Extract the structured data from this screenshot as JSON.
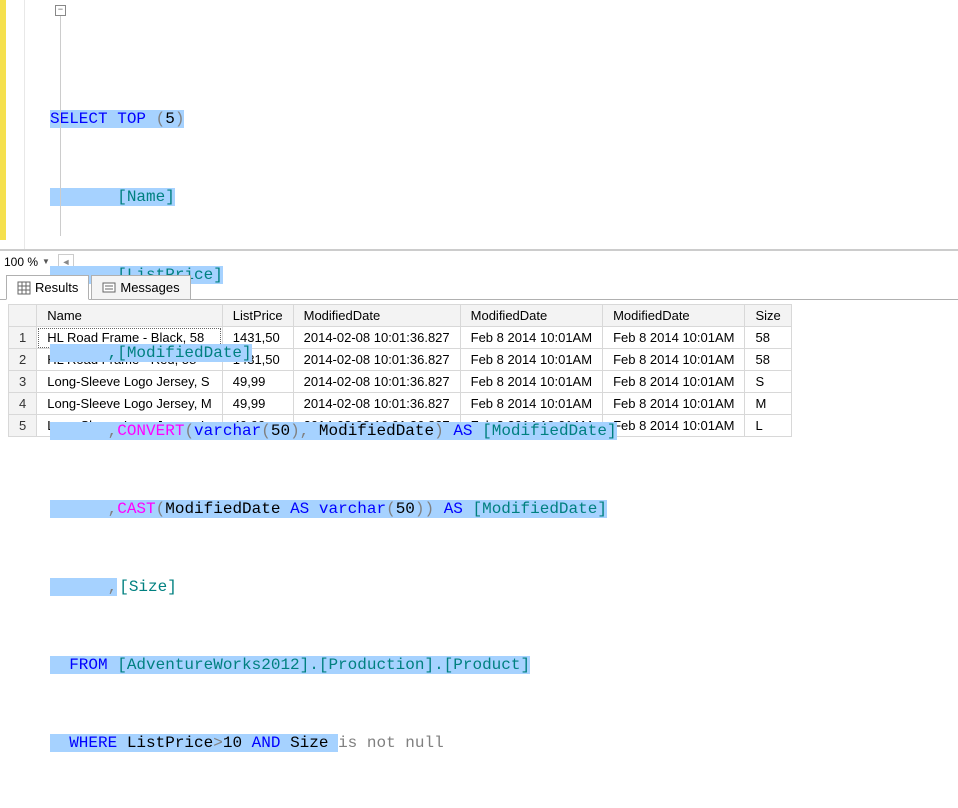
{
  "zoom": {
    "level": "100 %"
  },
  "code": {
    "collapse_glyph": "−",
    "line1_a": "SELECT",
    "line1_b": " TOP ",
    "line1_c": "(",
    "line1_d": "5",
    "line1_e": ")",
    "line2": "       [Name]",
    "line3": "      ,[ListPrice]",
    "line4": "      ,[ModifiedDate]",
    "line5_a": "      ,",
    "line5_b": "CONVERT",
    "line5_c": "(",
    "line5_d": "varchar",
    "line5_e": "(",
    "line5_f": "50",
    "line5_g": "),",
    "line5_h": " ModifiedDate",
    "line5_i": ")",
    "line5_j": " AS ",
    "line5_k": "[ModifiedDate]",
    "line6_a": "      ,",
    "line6_b": "CAST",
    "line6_c": "(",
    "line6_d": "ModifiedDate ",
    "line6_e": "AS",
    "line6_f": " varchar",
    "line6_g": "(",
    "line6_h": "50",
    "line6_i": "))",
    "line6_j": " AS ",
    "line6_k": "[ModifiedDate]",
    "line7_a": "      ,",
    "line7_b": "[Size]",
    "line8_a": "  FROM",
    "line8_b": " [AdventureWorks2012].[Production].[Product]",
    "line9_a": "  WHERE",
    "line9_b": " ListPrice",
    "line9_c": ">",
    "line9_d": "10 ",
    "line9_e": "AND",
    "line9_f": " Size ",
    "line9_g": "is not null"
  },
  "tabs": {
    "results": "Results",
    "messages": "Messages"
  },
  "grid": {
    "headers": [
      "Name",
      "ListPrice",
      "ModifiedDate",
      "ModifiedDate",
      "ModifiedDate",
      "Size"
    ],
    "rows": [
      {
        "n": "1",
        "Name": "HL Road Frame - Black, 58",
        "ListPrice": "1431,50",
        "ModifiedDate": "2014-02-08 10:01:36.827",
        "ModifiedDate2": "Feb  8 2014 10:01AM",
        "ModifiedDate3": "Feb  8 2014 10:01AM",
        "Size": "58"
      },
      {
        "n": "2",
        "Name": "HL Road Frame - Red, 58",
        "ListPrice": "1431,50",
        "ModifiedDate": "2014-02-08 10:01:36.827",
        "ModifiedDate2": "Feb  8 2014 10:01AM",
        "ModifiedDate3": "Feb  8 2014 10:01AM",
        "Size": "58"
      },
      {
        "n": "3",
        "Name": "Long-Sleeve Logo Jersey, S",
        "ListPrice": "49,99",
        "ModifiedDate": "2014-02-08 10:01:36.827",
        "ModifiedDate2": "Feb  8 2014 10:01AM",
        "ModifiedDate3": "Feb  8 2014 10:01AM",
        "Size": "S"
      },
      {
        "n": "4",
        "Name": "Long-Sleeve Logo Jersey, M",
        "ListPrice": "49,99",
        "ModifiedDate": "2014-02-08 10:01:36.827",
        "ModifiedDate2": "Feb  8 2014 10:01AM",
        "ModifiedDate3": "Feb  8 2014 10:01AM",
        "Size": "M"
      },
      {
        "n": "5",
        "Name": "Long-Sleeve Logo Jersey, L",
        "ListPrice": "49,99",
        "ModifiedDate": "2014-02-08 10:01:36.827",
        "ModifiedDate2": "Feb  8 2014 10:01AM",
        "ModifiedDate3": "Feb  8 2014 10:01AM",
        "Size": "L"
      }
    ]
  }
}
